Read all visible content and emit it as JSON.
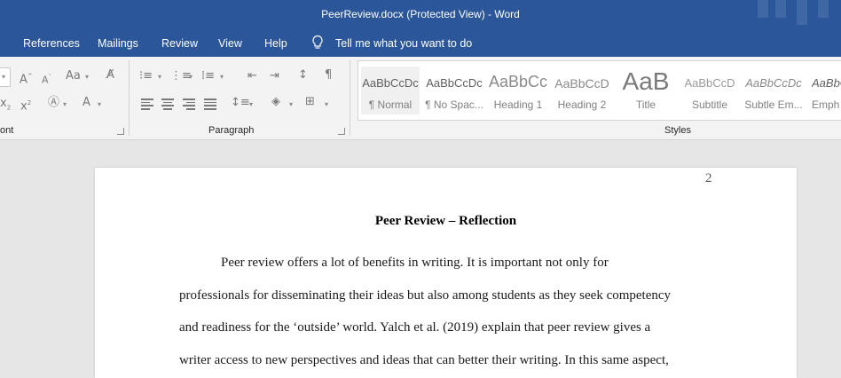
{
  "window": {
    "title": "PeerReview.docx (Protected View)  -  Word"
  },
  "menu": {
    "tabs": [
      "References",
      "Mailings",
      "Review",
      "View",
      "Help"
    ],
    "tell_me": "Tell me what you want to do"
  },
  "ribbon": {
    "groups": {
      "font": "ont",
      "paragraph": "Paragraph",
      "styles": "Styles"
    },
    "styles": [
      {
        "sample": "AaBbCcDc",
        "name": "¶ Normal"
      },
      {
        "sample": "AaBbCcDc",
        "name": "¶ No Spac..."
      },
      {
        "sample": "AaBbCc",
        "name": "Heading 1"
      },
      {
        "sample": "AaBbCcD",
        "name": "Heading 2"
      },
      {
        "sample": "AaB",
        "name": "Title"
      },
      {
        "sample": "AaBbCcD",
        "name": "Subtitle"
      },
      {
        "sample": "AaBbCcDc",
        "name": "Subtle Em..."
      },
      {
        "sample": "AaBbCcDc",
        "name": "Emph"
      }
    ]
  },
  "document": {
    "page_number": "2",
    "title": "Peer Review – Reflection",
    "lines": [
      "Peer review offers a lot of benefits in writing. It is important not only for",
      "professionals for disseminating their ideas but also among students as they seek competency",
      "and readiness for the ‘outside’ world. Yalch et al. (2019) explain that peer review gives a",
      "writer access to new perspectives and ideas that can better their writing. In this same aspect,"
    ]
  },
  "colors": {
    "title_bar": "#2b579a",
    "ribbon": "#f3f3f3",
    "workspace": "#e6e6e6"
  }
}
